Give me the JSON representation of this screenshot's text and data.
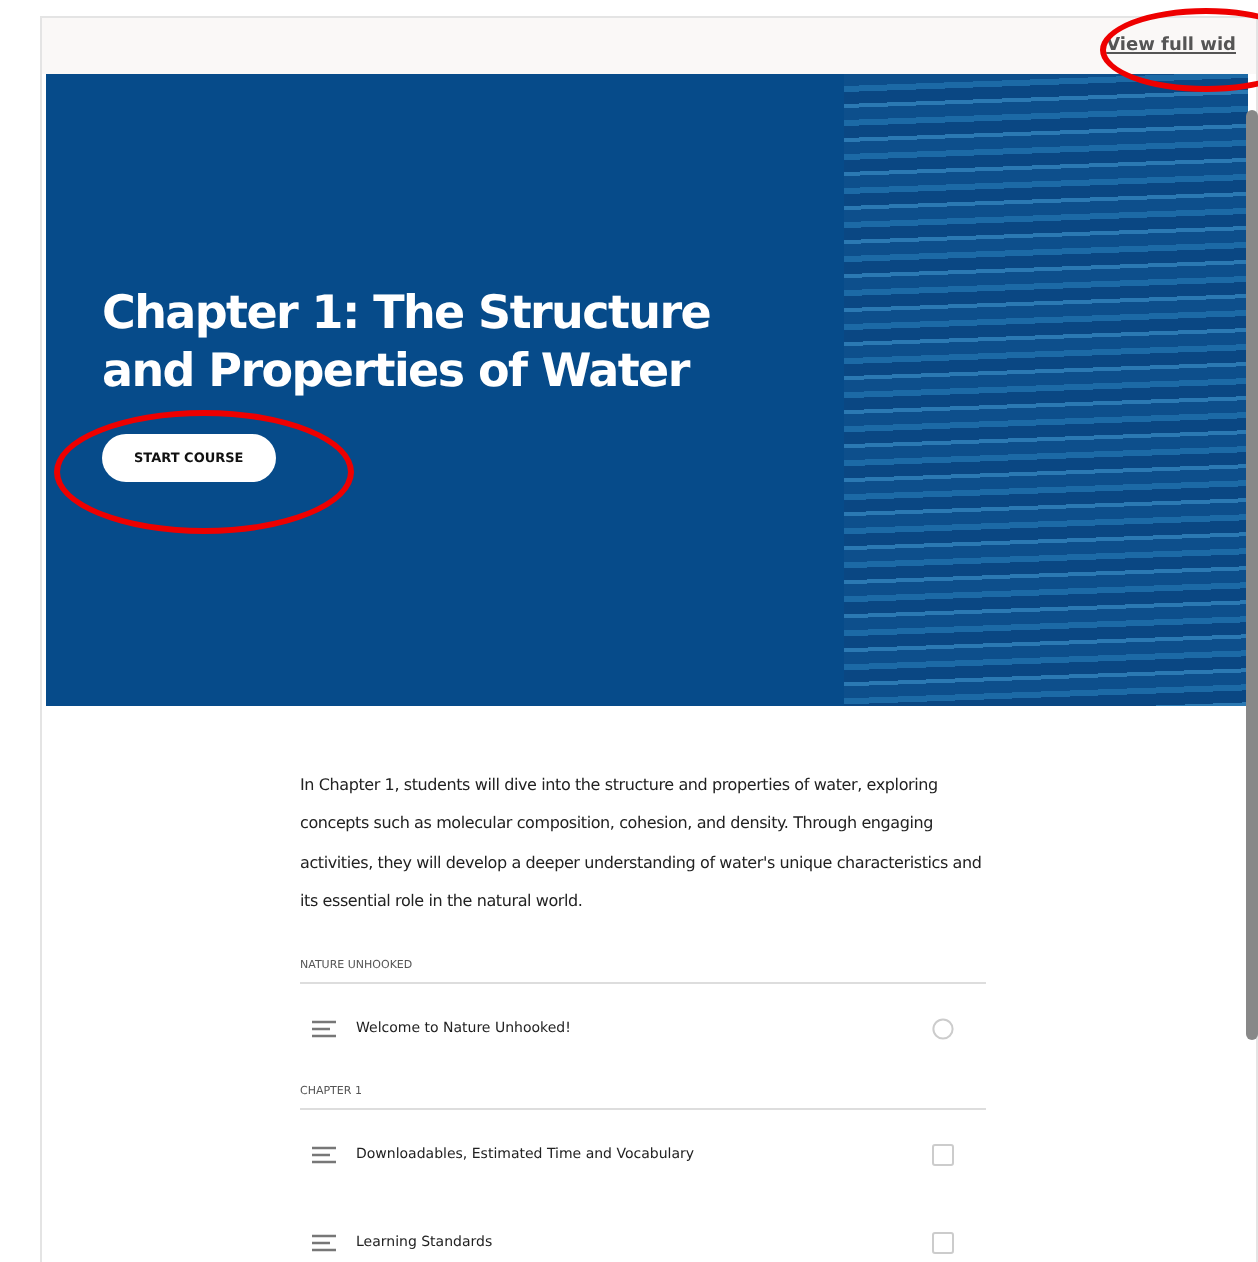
{
  "header": {
    "link": "View full wid"
  },
  "hero": {
    "title": "Chapter 1: The Structure and Properties of Water",
    "button": "START COURSE"
  },
  "description": "In Chapter 1, students will dive into the structure and properties of water, exploring concepts such as molecular composition, cohesion, and density. Through engaging activities, they will develop a deeper understanding of water's unique characteristics and its essential role in the natural world.",
  "sections": [
    {
      "title": "NATURE UNHOOKED",
      "lessons": [
        {
          "title": "Welcome to Nature Unhooked!",
          "kind": "circle"
        }
      ]
    },
    {
      "title": "CHAPTER 1",
      "lessons": [
        {
          "title": "Downloadables, Estimated Time and Vocabulary",
          "kind": "square"
        },
        {
          "title": "Learning Standards",
          "kind": "square"
        }
      ]
    }
  ]
}
